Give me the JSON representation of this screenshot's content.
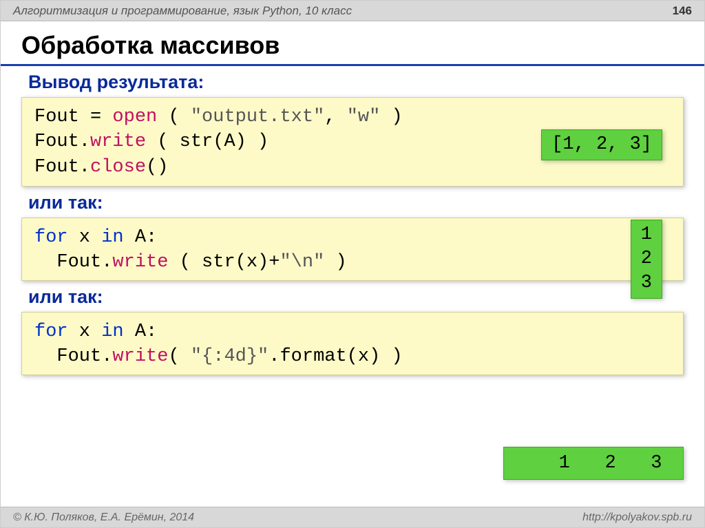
{
  "header": {
    "course": "Алгоритмизация и программирование, язык Python, 10 класс",
    "page": "146"
  },
  "title": "Обработка массивов",
  "sections": {
    "s1": {
      "heading": "Вывод результата:",
      "code": {
        "l1a": "Fout",
        "l1b": "=",
        "l1c": "open",
        "l1d": "(",
        "l1e": "\"output.txt\"",
        "l1f": ",",
        "l1g": "\"w\"",
        "l1h": ")",
        "l2a": "Fout.",
        "l2b": "write",
        "l2c": "( str(A) )",
        "l3a": "Fout.",
        "l3b": "close",
        "l3c": "()"
      },
      "output": "[1, 2, 3]"
    },
    "s2": {
      "heading": "или так:",
      "code": {
        "l1a": "for",
        "l1b": " x ",
        "l1c": "in",
        "l1d": " A:",
        "l2a": "  Fout.",
        "l2b": "write",
        "l2c": "( str(x)+",
        "l2d": "\"\\n\"",
        "l2e": " )"
      },
      "output": "1\n2\n3"
    },
    "s3": {
      "heading": "или так:",
      "code": {
        "l1a": "for",
        "l1b": " x ",
        "l1c": "in",
        "l1d": " A:",
        "l2a": "  Fout.",
        "l2b": "write",
        "l2c": "( ",
        "l2d": "\"{:4d}\"",
        "l2e": ".format(x) )"
      },
      "output": "   1   2   3"
    }
  },
  "footer": {
    "copyright": "© К.Ю. Поляков, Е.А. Ерёмин, 2014",
    "url": "http://kpolyakov.spb.ru"
  }
}
